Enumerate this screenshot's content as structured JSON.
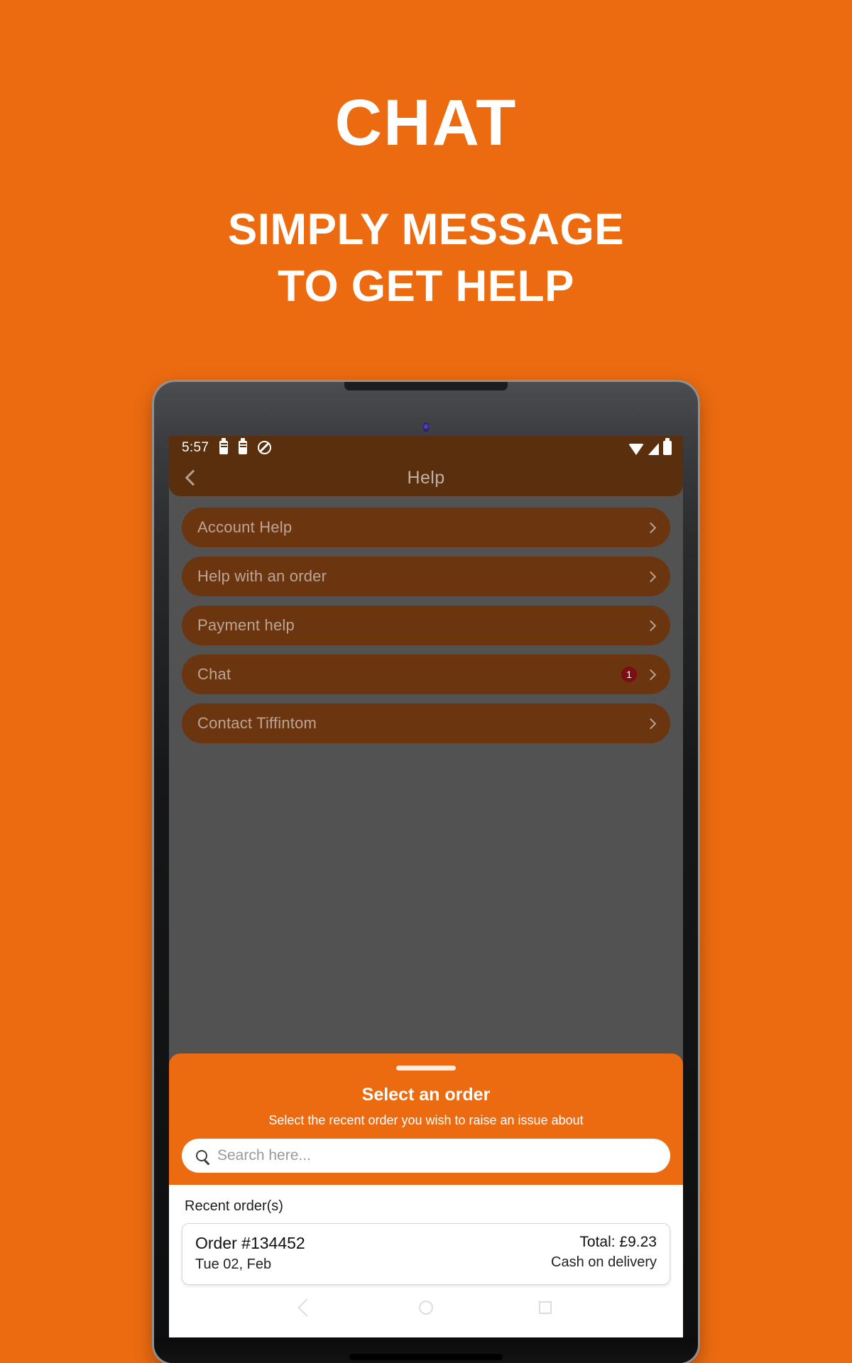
{
  "promo": {
    "title": "CHAT",
    "subtitle_line1": "SIMPLY MESSAGE",
    "subtitle_line2": "TO GET HELP",
    "background_color": "#EC6B10",
    "text_color": "#FFFFFF"
  },
  "status_bar": {
    "time": "5:57",
    "left_icons": [
      "battery-icon",
      "battery-icon",
      "do-not-disturb-icon"
    ],
    "right_icons": [
      "wifi-icon",
      "signal-icon",
      "battery-icon"
    ]
  },
  "app_bar": {
    "title": "Help",
    "back_icon": "chevron-left-icon",
    "background_color": "#5A2F0E"
  },
  "help_menu": {
    "items": [
      {
        "label": "Account Help",
        "badge": "",
        "chevron": "chevron-right-icon"
      },
      {
        "label": "Help with an order",
        "badge": "",
        "chevron": "chevron-right-icon"
      },
      {
        "label": "Payment help",
        "badge": "",
        "chevron": "chevron-right-icon"
      },
      {
        "label": "Chat",
        "badge": "1",
        "chevron": "chevron-right-icon"
      },
      {
        "label": "Contact Tiffintom",
        "badge": "",
        "chevron": "chevron-right-icon"
      }
    ],
    "badge_color": "#7C0D13",
    "item_color": "#6B3510"
  },
  "bottom_sheet": {
    "title": "Select an order",
    "subtitle": "Select the recent order you wish to raise an issue about",
    "accent_color": "#EC6B10",
    "search": {
      "placeholder": "Search here...",
      "value": "",
      "icon": "search-icon"
    },
    "recent_orders_label": "Recent order(s)",
    "orders": [
      {
        "order_id": "Order #134452",
        "date": "Tue 02, Feb",
        "total": "Total: £9.23",
        "payment": "Cash on delivery"
      }
    ]
  },
  "android_nav": {
    "back": "back-nav-icon",
    "home": "home-nav-icon",
    "recents": "recents-nav-icon"
  }
}
